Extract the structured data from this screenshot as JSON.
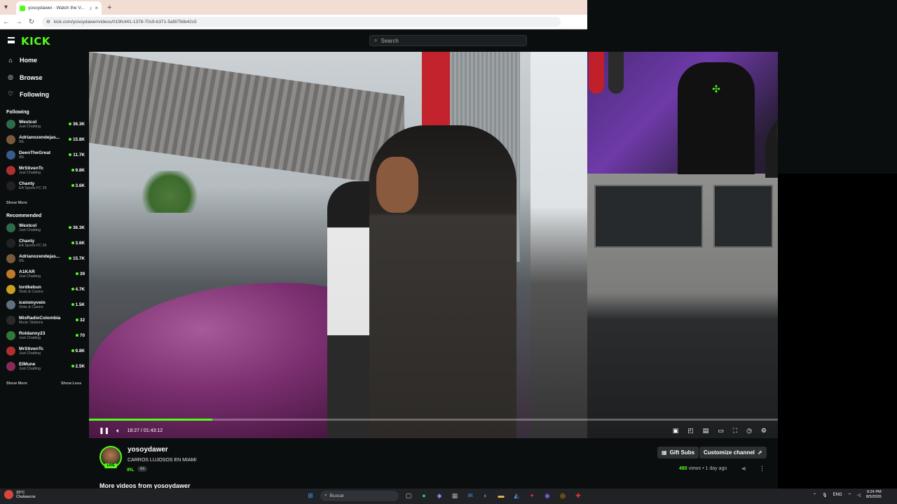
{
  "browser": {
    "tab_title": "yosoydawer - Watch the V...",
    "tab_close": "×",
    "new_tab": "+",
    "url": "kick.com/yosoydawer/videos/019fc441-1378-70c9-b371-5af8756b42c5"
  },
  "header": {
    "logo": "KICK",
    "search_placeholder": "Search"
  },
  "nav": {
    "home": "Home",
    "browse": "Browse",
    "following": "Following"
  },
  "following": {
    "title": "Following",
    "channels": [
      {
        "name": "Westcol",
        "category": "Just Chatting",
        "viewers": "36.3K",
        "color": "#2d6b4a"
      },
      {
        "name": "Adrianozendejas...",
        "category": "IRL",
        "viewers": "15.8K",
        "color": "#7a5a3a"
      },
      {
        "name": "DeenTheGreat",
        "category": "IRL",
        "viewers": "11.7K",
        "color": "#3a5a8a"
      },
      {
        "name": "MrStivenTc",
        "category": "Just Chatting",
        "viewers": "9.8K",
        "color": "#b03030"
      },
      {
        "name": "Chanty",
        "category": "EA Sports FC 26",
        "viewers": "3.6K",
        "color": "#222222"
      }
    ],
    "show_more": "Show More"
  },
  "recommended": {
    "title": "Recommended",
    "channels": [
      {
        "name": "Westcol",
        "category": "Just Chatting",
        "viewers": "36.3K",
        "color": "#2d6b4a"
      },
      {
        "name": "Chanty",
        "category": "EA Sports FC 26",
        "viewers": "3.6K",
        "color": "#222222"
      },
      {
        "name": "Adrianozendejas...",
        "category": "IRL",
        "viewers": "15.7K",
        "color": "#7a5a3a"
      },
      {
        "name": "A1KAR",
        "category": "Just Chatting",
        "viewers": "39",
        "color": "#c07a2a"
      },
      {
        "name": "lordkebun",
        "category": "Slots & Casino",
        "viewers": "4.7K",
        "color": "#c8a020"
      },
      {
        "name": "iceinmyvein",
        "category": "Slots & Casino",
        "viewers": "1.5K",
        "color": "#607080"
      },
      {
        "name": "MixRadioColombia",
        "category": "Music Stations",
        "viewers": "32",
        "color": "#2a2a2a"
      },
      {
        "name": "Roldanny23",
        "category": "Just Chatting",
        "viewers": "70",
        "color": "#2f7a3a"
      },
      {
        "name": "MrStivenTc",
        "category": "Just Chatting",
        "viewers": "9.8K",
        "color": "#b03030"
      },
      {
        "name": "ElMune",
        "category": "Just Chatting",
        "viewers": "2.5K",
        "color": "#8a2a5a"
      }
    ],
    "show_more": "Show More",
    "show_less": "Show Less"
  },
  "player": {
    "time": "18:27 / 01:43:12",
    "progress_fraction": 0.179
  },
  "video": {
    "channel": "yosoydawer",
    "title": "CARROS LUJOSOS EN MIAMI",
    "live_badge": "LIVE",
    "category": "IRL",
    "language": "es",
    "gift_subs": "Gift Subs",
    "customize": "Customize channel",
    "views_count": "480",
    "views_rest": " views  •  1 day ago",
    "more_videos": "More videos from yosoydawer"
  },
  "taskbar": {
    "temp": "33°C",
    "weather": "Chubascos",
    "search": "Buscar",
    "lang": "ENG",
    "time": "9:24 PM",
    "date": "8/5/2026"
  }
}
